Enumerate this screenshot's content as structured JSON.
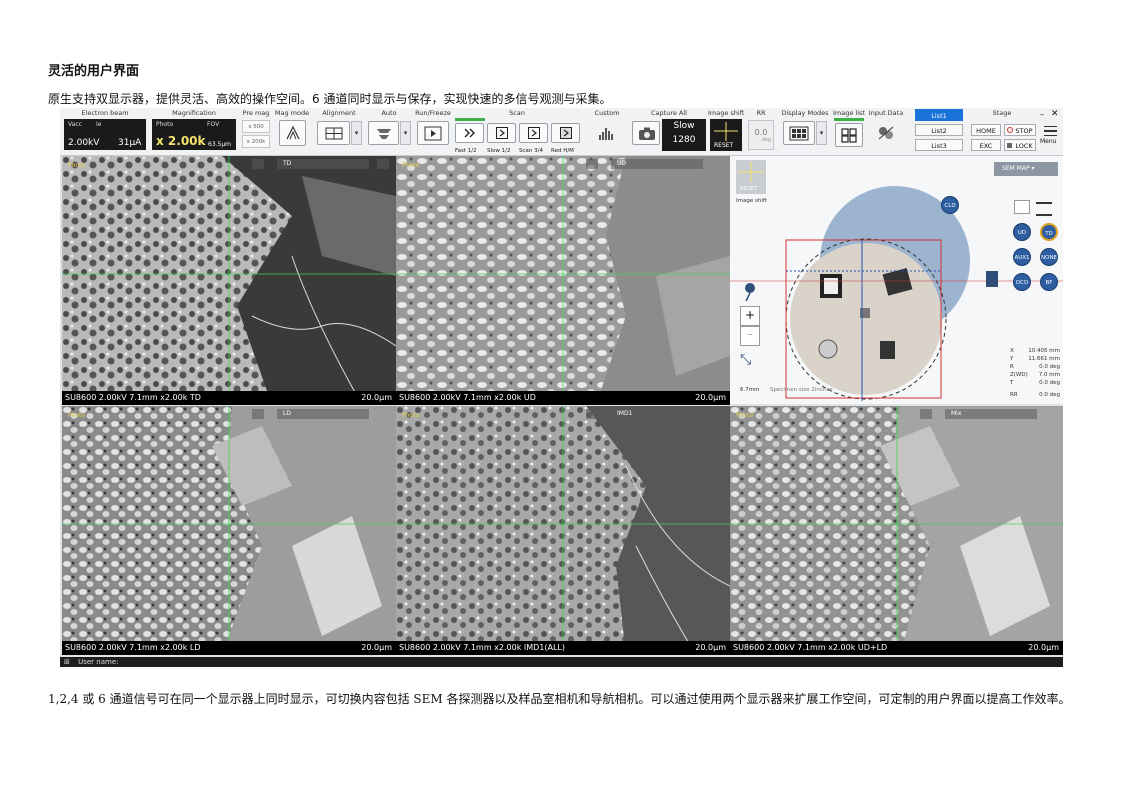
{
  "doc": {
    "title": "灵活的用户界面",
    "intro": "原生支持双显示器，提供灵活、高效的操作空间。6 通道同时显示与保存，实现快速的多信号观测与采集。",
    "outro": "1,2,4 或 6 通道信号可在同一个显示器上同时显示，可切换内容包括 SEM 各探测器以及样品室相机和导航相机。可以通过使用两个显示器来扩展工作空间，可定制的用户界面以提高工作效率。"
  },
  "toolbar": {
    "electron_beam": {
      "label": "Electron beam",
      "vacc_label": "Vacc",
      "ie_label": "Ie",
      "vacc_value": "2.00kV",
      "ie_value": "31μA"
    },
    "magnification": {
      "label": "Magnification",
      "photo_label": "Photo",
      "fov_label": "FOV",
      "value": "x 2.00k",
      "fov_value": "63.5μm"
    },
    "pre_mag": {
      "label": "Pre mag",
      "opt1": "x 500",
      "opt2": "x 200k"
    },
    "mag_mode": {
      "label": "Mag mode"
    },
    "alignment": {
      "label": "Alignment"
    },
    "auto": {
      "label": "Auto"
    },
    "run_freeze": {
      "label": "Run/Freeze"
    },
    "scan": {
      "label": "Scan",
      "b1": "Fast 1/2",
      "b2": "Slow 1/2",
      "b3": "Scan 3/4",
      "b4": "Red H/M"
    },
    "custom": {
      "label": "Custom"
    },
    "capture_all": {
      "label": "Capture All",
      "speed": "Slow",
      "lines": "1280"
    },
    "image_shift": {
      "label": "Image shift",
      "reset": "RESET"
    },
    "rr": {
      "label": "RR",
      "value": "0.0",
      "unit": "deg"
    },
    "display_modes": {
      "label": "Display Modes"
    },
    "image_list": {
      "label": "Image list"
    },
    "input_data": {
      "label": "Input Data"
    },
    "lists": [
      "List1",
      "List2",
      "List3"
    ],
    "stage": {
      "label": "Stage",
      "home": "HOME",
      "stop": "STOP",
      "exc": "EXC",
      "lock": "LOCK"
    },
    "menu": "Menu"
  },
  "panels": [
    {
      "tag": "TD",
      "footer_left": "SU8600 2.00kV 7.1mm x2.00k TD",
      "footer_right": "20.0μm",
      "photo": "Photo"
    },
    {
      "tag": "UD",
      "footer_left": "SU8600 2.00kV 7.1mm x2.00k UD",
      "footer_right": "20.0μm",
      "photo": "Photo"
    },
    {
      "tag": "LD",
      "footer_left": "SU8600 2.00kV 7.1mm x2.00k LD",
      "footer_right": "20.0μm",
      "photo": "Photo"
    },
    {
      "tag": "IMD1",
      "footer_left": "SU8600 2.00kV 7.1mm x2.00k IMD1(ALL)",
      "footer_right": "20.0μm",
      "photo": "Photo"
    },
    {
      "tag": "Mix",
      "footer_left": "SU8600 2.00kV 7.1mm x2.00k UD+LD",
      "footer_right": "20.0μm",
      "photo": "Photo"
    }
  ],
  "map": {
    "reset": "RESET",
    "image_shift": "Image shift",
    "sem_map": "SEM MAP",
    "cld": "CLD",
    "buttons": [
      "UD",
      "TD",
      "AUX1",
      "NONE",
      "OCD",
      "BF"
    ],
    "scale": "6.7mm",
    "specimen": "Specimen size 2inches",
    "coords": [
      {
        "k": "X",
        "v": "10.405 mm"
      },
      {
        "k": "Y",
        "v": "11.661 mm"
      },
      {
        "k": "R",
        "v": "0.0 deg"
      },
      {
        "k": "Z(WD)",
        "v": "7.0 mm"
      },
      {
        "k": "T",
        "v": "0.0 deg"
      },
      {
        "k": "RR",
        "v": "0.0 deg"
      }
    ]
  },
  "status": {
    "user": "User name:"
  }
}
